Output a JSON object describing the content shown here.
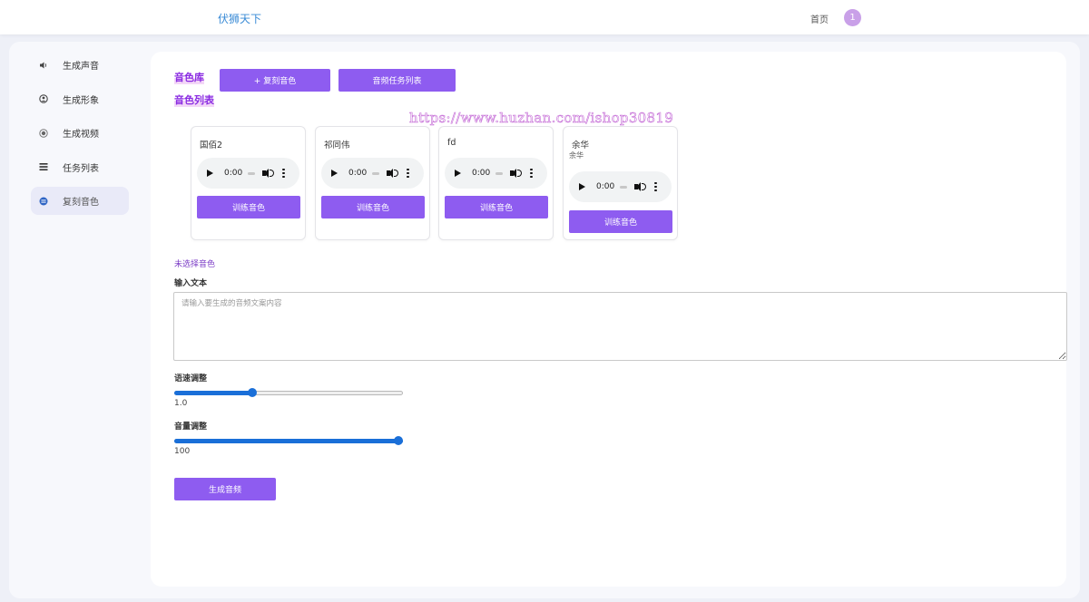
{
  "header": {
    "brand": "伏狮天下",
    "home": "首页",
    "avatar_text": "1"
  },
  "sidebar": {
    "items": [
      {
        "label": "生成声音",
        "icon": "speaker-icon",
        "active": false
      },
      {
        "label": "生成形象",
        "icon": "user-circle-icon",
        "active": false
      },
      {
        "label": "生成视频",
        "icon": "record-icon",
        "active": false
      },
      {
        "label": "任务列表",
        "icon": "list-icon",
        "active": false
      },
      {
        "label": "复刻音色",
        "icon": "voice-circle-icon",
        "active": true
      }
    ]
  },
  "main": {
    "library_title": "音色库",
    "clone_button": "+ 复刻音色",
    "tasks_button": "音频任务列表",
    "list_title": "音色列表",
    "watermark": "https://www.huzhan.com/ishop30819",
    "voices": [
      {
        "name": "国佰2",
        "subtitle": "",
        "time": "0:00",
        "train_label": "训练音色"
      },
      {
        "name": "祁同伟",
        "subtitle": "",
        "time": "0:00",
        "train_label": "训练音色"
      },
      {
        "name": "fd",
        "subtitle": "",
        "time": "0:00",
        "train_label": "训练音色"
      },
      {
        "name": "余华",
        "subtitle": "余华",
        "time": "0:00",
        "train_label": "训练音色"
      }
    ],
    "unselected": "未选择音色",
    "input_label": "输入文本",
    "input_placeholder": "请输入要生成的音频文案内容",
    "speed": {
      "label": "语速调整",
      "value": "1.0",
      "fraction": 0.34
    },
    "volume": {
      "label": "音量调整",
      "value": "100",
      "fraction": 1.0
    },
    "generate_button": "生成音频"
  },
  "colors": {
    "accent": "#8e5cf0",
    "title": "#8a2be2",
    "slider": "#1a6fd8",
    "brand": "#3a8bd6"
  }
}
